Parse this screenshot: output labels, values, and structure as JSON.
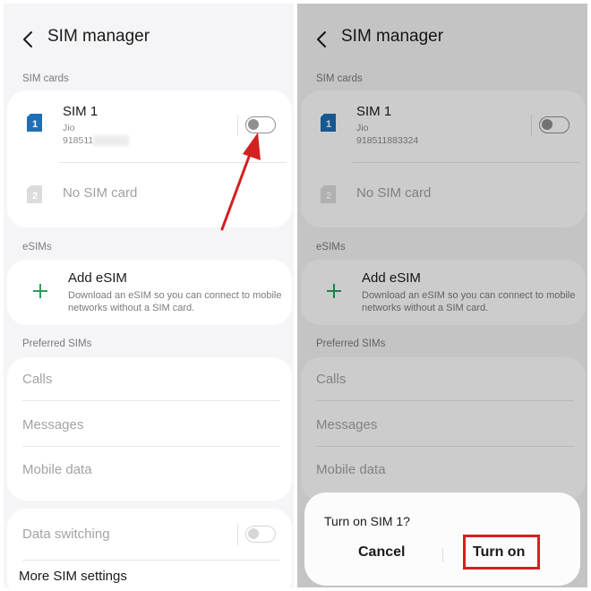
{
  "left": {
    "title": "SIM manager",
    "sim_cards_label": "SIM cards",
    "sim1": {
      "name": "SIM 1",
      "carrier": "Jio",
      "number_visible": "918511",
      "slot": "1"
    },
    "sim2": {
      "label": "No SIM card",
      "slot": "2"
    },
    "esims_label": "eSIMs",
    "esim": {
      "title": "Add eSIM",
      "description": "Download an eSIM so you can connect to mobile networks without a SIM card."
    },
    "preferred_label": "Preferred SIMs",
    "preferred_items": [
      "Calls",
      "Messages",
      "Mobile data"
    ],
    "data_switching": "Data switching",
    "more_settings": "More SIM settings"
  },
  "right": {
    "title": "SIM manager",
    "sim_cards_label": "SIM cards",
    "sim1": {
      "name": "SIM 1",
      "carrier": "Jio",
      "number": "918511883324",
      "slot": "1"
    },
    "sim2": {
      "label": "No SIM card",
      "slot": "2"
    },
    "esims_label": "eSIMs",
    "esim": {
      "title": "Add eSIM",
      "description": "Download an eSIM so you can connect to mobile networks without a SIM card."
    },
    "preferred_label": "Preferred SIMs",
    "preferred_items": [
      "Calls",
      "Messages",
      "Mobile data"
    ],
    "dialog": {
      "title": "Turn on SIM 1?",
      "cancel": "Cancel",
      "confirm": "Turn on"
    }
  },
  "colors": {
    "accent_green": "#2e9e5b",
    "sim_blue": "#1f6fb5",
    "highlight_red": "#d42020"
  },
  "icons": {
    "back": "back-arrow-icon",
    "sim": "sim-card-icon",
    "add": "plus-icon"
  }
}
